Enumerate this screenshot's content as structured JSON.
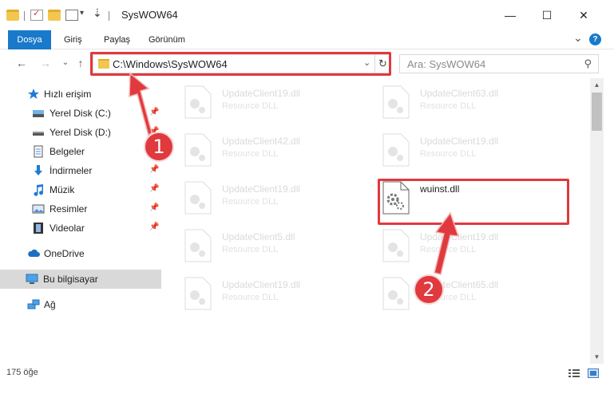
{
  "window": {
    "title": "SysWOW64",
    "minimize": "—",
    "maximize": "☐",
    "close": "✕"
  },
  "ribbon": {
    "tabs": [
      "Dosya",
      "Giriş",
      "Paylaş",
      "Görünüm"
    ],
    "expand": "⌄",
    "help": "?"
  },
  "nav": {
    "back": "←",
    "forward": "→",
    "up_arrow": "↑",
    "recent": "⌄",
    "address": "C:\\Windows\\SysWOW64",
    "address_dropdown": "⌄",
    "refresh": "↻",
    "search_placeholder": "Ara: SysWOW64",
    "search_icon": "⚲"
  },
  "sidebar": {
    "items": [
      {
        "label": "Hızlı erişim",
        "icon": "star-icon",
        "pinned": false
      },
      {
        "label": "Yerel Disk (C:)",
        "icon": "drive-icon",
        "pinned": true
      },
      {
        "label": "Yerel Disk (D:)",
        "icon": "drive-icon",
        "pinned": true
      },
      {
        "label": "Belgeler",
        "icon": "document-icon",
        "pinned": true
      },
      {
        "label": "İndirmeler",
        "icon": "download-icon",
        "pinned": true
      },
      {
        "label": "Müzik",
        "icon": "music-icon",
        "pinned": true
      },
      {
        "label": "Resimler",
        "icon": "pictures-icon",
        "pinned": true
      },
      {
        "label": "Videolar",
        "icon": "video-icon",
        "pinned": true
      },
      {
        "label": "OneDrive",
        "icon": "cloud-icon",
        "pinned": false
      },
      {
        "label": "Bu bilgisayar",
        "icon": "computer-icon",
        "pinned": false
      },
      {
        "label": "Ağ",
        "icon": "network-icon",
        "pinned": false
      }
    ],
    "pin_glyph": "📌"
  },
  "files": [
    {
      "name": "UpdateClient19.dll",
      "type": "Resource DLL",
      "highlighted": false
    },
    {
      "name": "UpdateClient63.dll",
      "type": "Resource DLL",
      "highlighted": false
    },
    {
      "name": "UpdateClient42.dll",
      "type": "Resource DLL",
      "highlighted": false
    },
    {
      "name": "UpdateClient19.dll",
      "type": "Resource DLL",
      "highlighted": false
    },
    {
      "name": "UpdateClient19.dll",
      "type": "Resource DLL",
      "highlighted": false
    },
    {
      "name": "wuinst.dll",
      "type": "",
      "highlighted": true
    },
    {
      "name": "UpdateClient5.dll",
      "type": "Resource DLL",
      "highlighted": false
    },
    {
      "name": "UpdateClient19.dll",
      "type": "Resource DLL",
      "highlighted": false
    },
    {
      "name": "UpdateClient19.dll",
      "type": "Resource DLL",
      "highlighted": false
    },
    {
      "name": "UpdateClient65.dll",
      "type": "Resource DLL",
      "highlighted": false
    }
  ],
  "status": {
    "item_count": "175 öğe"
  },
  "annotations": {
    "step1": "1",
    "step2": "2"
  },
  "colors": {
    "accent": "#1979ca",
    "annotation_red": "#e0393e"
  }
}
